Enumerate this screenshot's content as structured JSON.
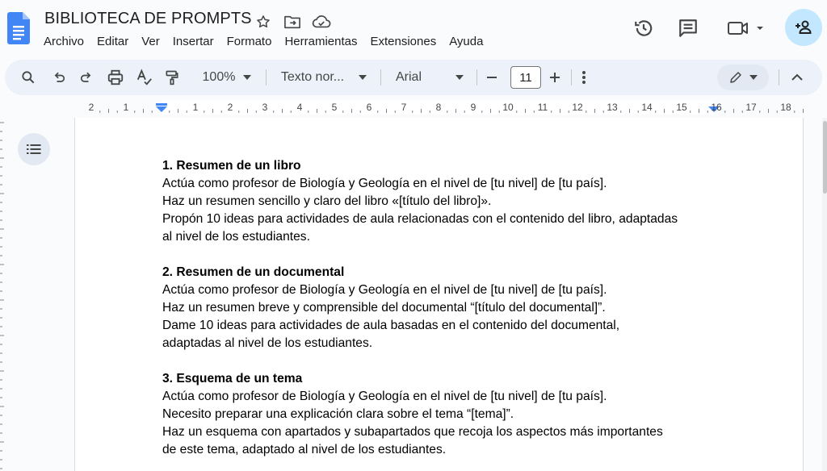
{
  "header": {
    "title": "BIBLIOTECA DE PROMPTS",
    "menu": [
      "Archivo",
      "Editar",
      "Ver",
      "Insertar",
      "Formato",
      "Herramientas",
      "Extensiones",
      "Ayuda"
    ],
    "title_icons": [
      "star-icon",
      "move-to-folder-icon",
      "cloud-saved-icon"
    ],
    "actions": [
      "version-history-icon",
      "comments-icon",
      "meet-video-icon",
      "share-add-person-icon"
    ]
  },
  "toolbar": {
    "zoom": "100%",
    "style": "Texto nor...",
    "font": "Arial",
    "font_size": "11",
    "icons": [
      "search-icon",
      "undo-icon",
      "redo-icon",
      "print-icon",
      "spellcheck-icon",
      "paint-format-icon",
      "more-vert-icon",
      "edit-pencil-icon",
      "collapse-icon"
    ]
  },
  "ruler": {
    "numbers": [
      "2",
      "1",
      "1",
      "2",
      "3",
      "4",
      "5",
      "6",
      "7",
      "8",
      "9",
      "10",
      "11",
      "12",
      "13",
      "14",
      "15",
      "16",
      "17",
      "18"
    ]
  },
  "document": {
    "sections": [
      {
        "heading": "1. Resumen de un libro",
        "lines": [
          "Actúa como profesor de Biología y Geología en el nivel de [tu nivel] de [tu país].",
          "Haz un resumen sencillo y claro del libro «[título del libro]».",
          "Propón 10 ideas para actividades de aula relacionadas con el contenido del libro, adaptadas",
          "al nivel de los estudiantes."
        ]
      },
      {
        "heading": "2. Resumen de un documental",
        "lines": [
          "Actúa como profesor de Biología y Geología en el nivel de [tu nivel] de [tu país].",
          "Haz un resumen breve y comprensible del documental “[título del documental]”.",
          "Dame 10 ideas para actividades de aula basadas en el contenido del documental,",
          "adaptadas al nivel de los estudiantes."
        ]
      },
      {
        "heading": "3. Esquema de un tema",
        "lines": [
          "Actúa como profesor de Biología y Geología en el nivel de [tu nivel] de [tu país].",
          "Necesito preparar una explicación clara sobre el tema “[tema]”.",
          "Haz un esquema con apartados y subapartados que recoja los aspectos más importantes",
          "de este tema, adaptado al nivel de los estudiantes."
        ]
      }
    ]
  },
  "colors": {
    "accent_blue": "#4285f4",
    "share_bg": "#c2e7ff",
    "toolbar_bg": "#edf2fa"
  }
}
